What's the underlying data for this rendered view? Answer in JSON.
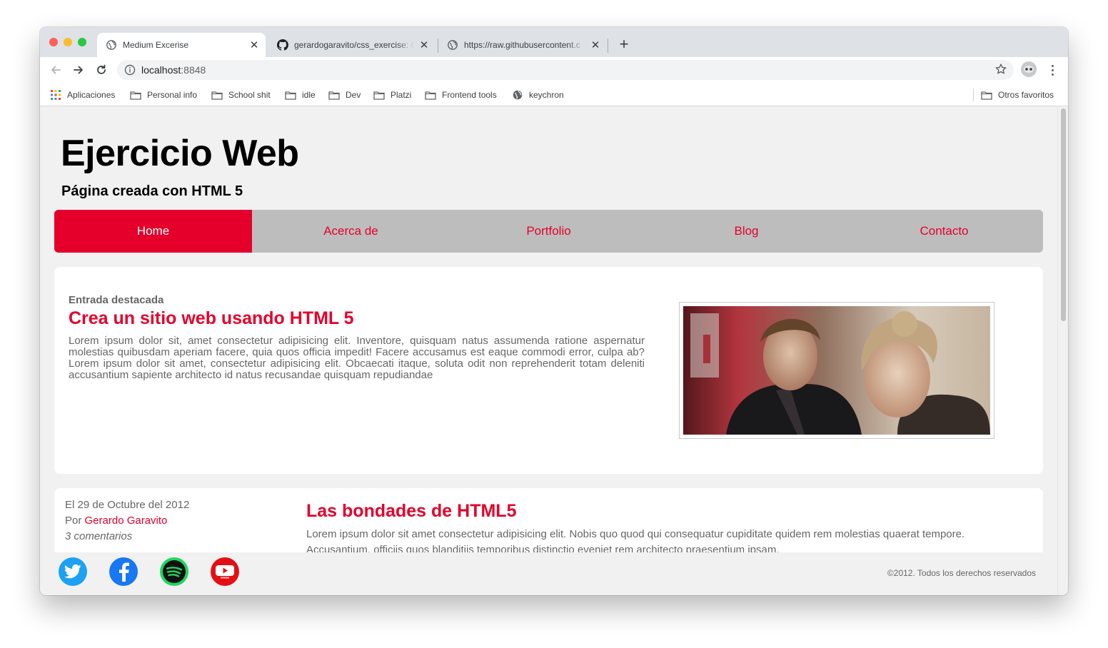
{
  "browser": {
    "tabs": [
      {
        "title": "Medium Excerise",
        "active": true
      },
      {
        "title": "gerardogaravito/css_exercise: C",
        "active": false
      },
      {
        "title": "https://raw.githubusercontent.c",
        "active": false
      }
    ],
    "new_tab_label": "+",
    "url_host": "localhost",
    "url_port": ":8848",
    "bookmarks": [
      {
        "label": "Aplicaciones",
        "icon": "apps-grid-icon"
      },
      {
        "label": "Personal info",
        "icon": "folder-icon"
      },
      {
        "label": "School shit",
        "icon": "folder-icon"
      },
      {
        "label": "idle",
        "icon": "folder-icon"
      },
      {
        "label": "Dev",
        "icon": "folder-icon"
      },
      {
        "label": "Platzi",
        "icon": "folder-icon"
      },
      {
        "label": "Frontend tools",
        "icon": "folder-icon"
      },
      {
        "label": "keychron",
        "icon": "globe-icon"
      }
    ],
    "other_bookmarks": "Otros favoritos"
  },
  "site": {
    "title": "Ejercicio Web",
    "subtitle": "Página creada con HTML 5",
    "nav": [
      "Home",
      "Acerca de",
      "Portfolio",
      "Blog",
      "Contacto"
    ],
    "active_nav": "Home",
    "accent_color": "#e4002b"
  },
  "featured": {
    "kicker": "Entrada destacada",
    "headline": "Crea un sitio web usando HTML 5",
    "body": "Lorem ipsum dolor sit, amet consectetur adipisicing elit. Inventore, quisquam natus assumenda ratione aspernatur molestias quibusdam aperiam facere, quia quos officia impedit! Facere accusamus est eaque commodi error, culpa ab? Lorem ipsum dolor sit amet, consectetur adipisicing elit. Obcaecati itaque, soluta odit non reprehenderit totam deleniti accusantium sapiente architecto id natus recusandae quisquam repudiandae"
  },
  "post": {
    "date": "El 29 de Octubre del 2012",
    "by_prefix": "Por ",
    "author": "Gerardo Garavito",
    "comments": "3 comentarios",
    "title": "Las bondades de HTML5",
    "body": "Lorem ipsum dolor sit amet consectetur adipisicing elit. Nobis quo quod qui consequatur cupiditate quidem rem molestias quaerat tempore. Accusantium, officiis quos blanditiis temporibus distinctio eveniet rem architecto praesentium ipsam."
  },
  "footer": {
    "social": [
      "twitter-icon",
      "facebook-icon",
      "spotify-icon",
      "youtube-icon"
    ],
    "copyright": "©2012. Todos los derechos reservados"
  }
}
